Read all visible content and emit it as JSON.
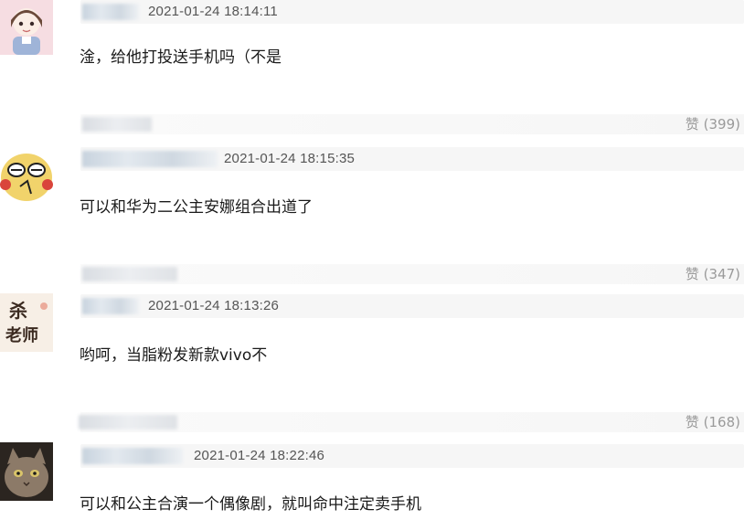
{
  "comments": [
    {
      "timestamp": "2021-01-24 18:14:11",
      "text": "淦，给他打投送手机吗（不是",
      "likes": "赞 (399)"
    },
    {
      "timestamp": "2021-01-24 18:15:35",
      "text": "可以和华为二公主安娜组合出道了",
      "likes": "赞 (347)"
    },
    {
      "timestamp": "2021-01-24 18:13:26",
      "text": "哟呵，当脂粉发新款vivo不",
      "avatar_text": "杀\n老师",
      "likes": "赞 (168)"
    },
    {
      "timestamp": "2021-01-24 18:22:46",
      "text": "可以和公主合演一个偶像剧，就叫命中注定卖手机"
    }
  ]
}
